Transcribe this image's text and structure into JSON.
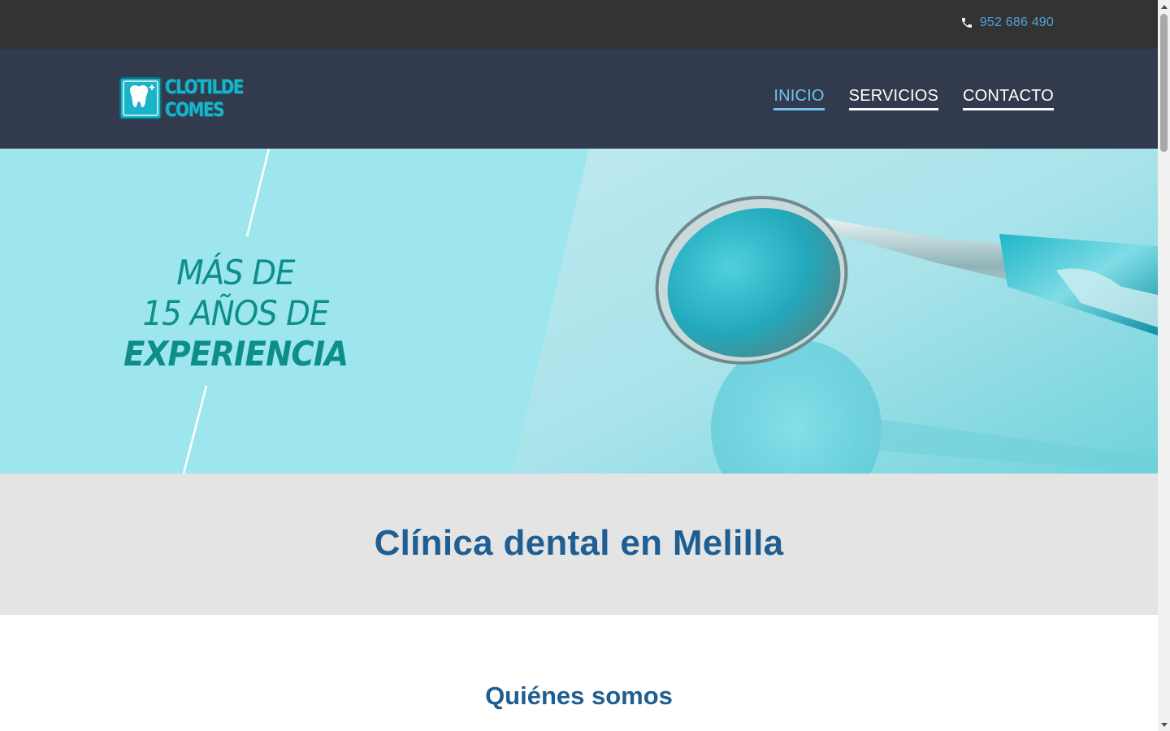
{
  "topbar": {
    "phone": "952 686 490",
    "phone_icon": "phone-icon",
    "phone_color": "#4ea3d8"
  },
  "header": {
    "logo": {
      "line1": "CLOTILDE",
      "line2": "COMES",
      "icon": "tooth-logo-icon",
      "color": "#1ab3c9"
    },
    "nav": [
      {
        "label": "INICIO",
        "active": true
      },
      {
        "label": "SERVICIOS",
        "active": false
      },
      {
        "label": "CONTACTO",
        "active": false
      }
    ],
    "background": "#323a4d"
  },
  "hero": {
    "line1": "MÁS DE",
    "line2": "15 AÑOS DE",
    "line3": "EXPERIENCIA",
    "image": "dental-mirror-image",
    "background": "#9de6ee",
    "text_color": "#0e8e8b"
  },
  "main": {
    "title": "Clínica dental en Melilla",
    "title_color": "#1f5e92"
  },
  "about": {
    "title": "Quiénes somos"
  }
}
